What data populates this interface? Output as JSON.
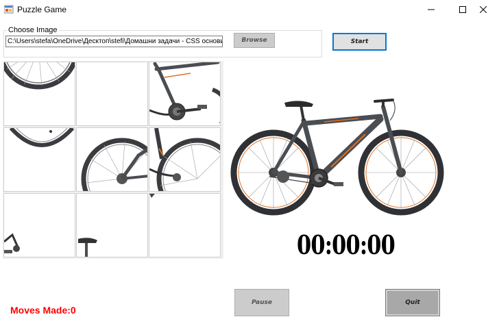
{
  "window": {
    "title": "Puzzle Game"
  },
  "image_group": {
    "legend": "Choose Image",
    "path_value": "C:\\Users\\stefa\\OneDrive\\Десктоп\\stefi\\Домашни задачи - CSS основи\\...",
    "browse_label": "Browse"
  },
  "controls": {
    "start_label": "Start",
    "pause_label": "Pause",
    "quit_label": "Quit"
  },
  "timer": {
    "value": "00:00:00"
  },
  "moves": {
    "text": "Moves Made:0"
  },
  "puzzle": {
    "rows": 3,
    "cols": 3,
    "tiles": [
      {
        "name": "tile-1",
        "content": "rear-wheel-top"
      },
      {
        "name": "tile-2",
        "content": "blank"
      },
      {
        "name": "tile-3",
        "content": "frame-crankset"
      },
      {
        "name": "tile-4",
        "content": "rear-wheel-bottom"
      },
      {
        "name": "tile-5",
        "content": "rear-wheel-hub"
      },
      {
        "name": "tile-6",
        "content": "front-wheel-fork"
      },
      {
        "name": "tile-7",
        "content": "pedal-corner"
      },
      {
        "name": "tile-8",
        "content": "saddle-top"
      },
      {
        "name": "tile-9",
        "content": "blank"
      }
    ]
  },
  "colors": {
    "accent": "#0078d7",
    "moves_text": "#ff0000",
    "bike_frame": "#4a4d52",
    "bike_accent": "#e07020"
  }
}
